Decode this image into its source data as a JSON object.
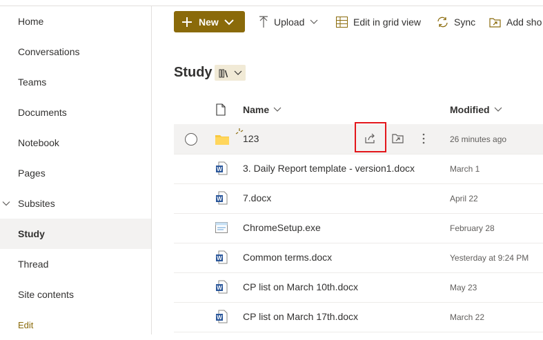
{
  "sidebar": {
    "items": [
      {
        "label": "Home"
      },
      {
        "label": "Conversations"
      },
      {
        "label": "Teams"
      },
      {
        "label": "Documents"
      },
      {
        "label": "Notebook"
      },
      {
        "label": "Pages"
      },
      {
        "label": "Subsites"
      },
      {
        "label": "Study"
      },
      {
        "label": "Thread"
      },
      {
        "label": "Site contents"
      },
      {
        "label": "Edit"
      }
    ]
  },
  "commandbar": {
    "new_label": "New",
    "upload_label": "Upload",
    "grid_label": "Edit in grid view",
    "sync_label": "Sync",
    "add_shortcut_label": "Add sho"
  },
  "library": {
    "title": "Study"
  },
  "columns": {
    "name": "Name",
    "modified": "Modified"
  },
  "files": [
    {
      "name": "123",
      "modified": "26 minutes ago",
      "type": "folder"
    },
    {
      "name": "3. Daily Report template - version1.docx",
      "modified": "March 1",
      "type": "word"
    },
    {
      "name": "7.docx",
      "modified": "April 22",
      "type": "word"
    },
    {
      "name": "ChromeSetup.exe",
      "modified": "February 28",
      "type": "exe"
    },
    {
      "name": "Common terms.docx",
      "modified": "Yesterday at 9:24 PM",
      "type": "word"
    },
    {
      "name": "CP list on March 10th.docx",
      "modified": "May 23",
      "type": "word"
    },
    {
      "name": "CP list on March 17th.docx",
      "modified": "March 22",
      "type": "word"
    }
  ],
  "colors": {
    "accent": "#8a6a0a",
    "highlight": "#e3151a",
    "selected_row": "#f3f2f1"
  }
}
